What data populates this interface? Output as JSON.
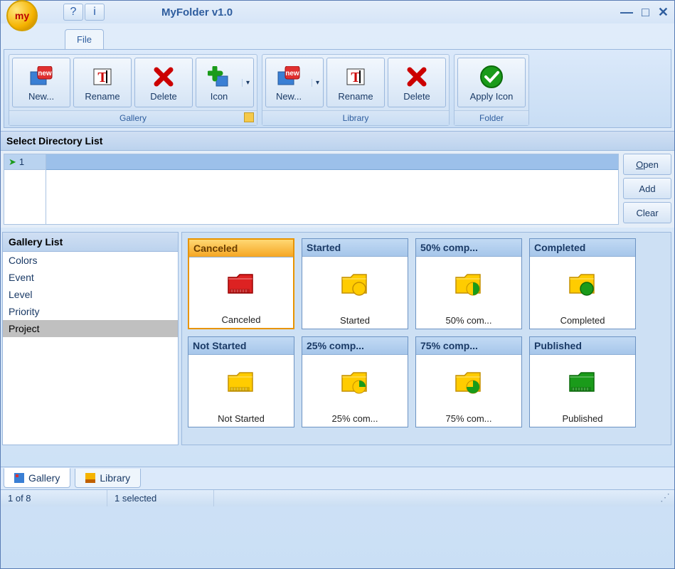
{
  "app": {
    "title": "MyFolder v1.0",
    "logo_text": "my"
  },
  "menu": {
    "file_tab": "File"
  },
  "ribbon": {
    "gallery": {
      "label": "Gallery",
      "new": "New...",
      "rename": "Rename",
      "delete": "Delete",
      "icon": "Icon"
    },
    "library": {
      "label": "Library",
      "new": "New...",
      "rename": "Rename",
      "delete": "Delete"
    },
    "folder": {
      "label": "Folder",
      "apply_icon": "Apply Icon"
    }
  },
  "directory": {
    "header": "Select Directory List",
    "row_number": "1",
    "buttons": {
      "open": "Open",
      "add": "Add",
      "clear": "Clear"
    }
  },
  "gallery_list": {
    "header": "Gallery List",
    "items": [
      "Colors",
      "Event",
      "Level",
      "Priority",
      "Project"
    ],
    "selected_index": 4
  },
  "icons": [
    {
      "title": "Canceled",
      "label": "Canceled",
      "color": "#d22",
      "kind": "solid"
    },
    {
      "title": "Started",
      "label": "Started",
      "color": "#f5b300",
      "kind": "circle-yellow"
    },
    {
      "title": "50% comp...",
      "label": "50% com...",
      "color": "#f5b300",
      "kind": "pie-50"
    },
    {
      "title": "Completed",
      "label": "Completed",
      "color": "#1a9b1a",
      "kind": "circle-green"
    },
    {
      "title": "Not Started",
      "label": "Not Started",
      "color": "#f5b300",
      "kind": "solid-yellow"
    },
    {
      "title": "25% comp...",
      "label": "25% com...",
      "color": "#f5b300",
      "kind": "pie-25"
    },
    {
      "title": "75% comp...",
      "label": "75% com...",
      "color": "#f5b300",
      "kind": "pie-75"
    },
    {
      "title": "Published",
      "label": "Published",
      "color": "#1a9b1a",
      "kind": "solid-green"
    }
  ],
  "selected_icon_index": 0,
  "bottom_tabs": {
    "gallery": "Gallery",
    "library": "Library"
  },
  "status": {
    "count": "1 of 8",
    "selected": "1 selected"
  }
}
